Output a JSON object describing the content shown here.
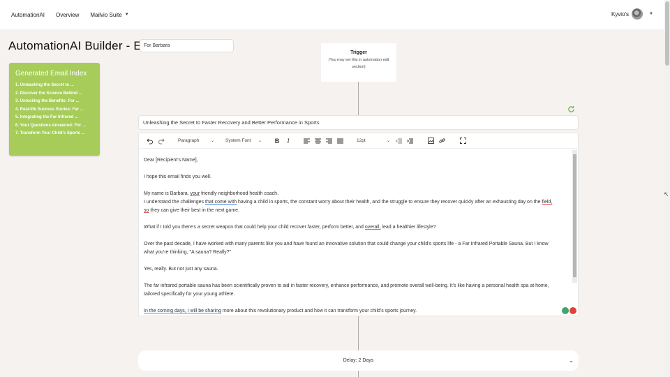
{
  "nav": {
    "brand": "AutomationAI",
    "overview": "Overview",
    "suite": "Mailvio Suite",
    "user": "Kyvio's"
  },
  "page": {
    "title": "AutomationAI Builder - Edit",
    "name_value": "For Barbara"
  },
  "index": {
    "title": "Generated Email Index",
    "items": [
      "1. Unleashing the Secret to ...",
      "2. Discover the Science Behind ...",
      "3. Unlocking the Benefits: For ...",
      "4. Real-life Success Stories: Far ...",
      "5. Integrating the Far Infrared ...",
      "6. Your Questions Answered: For ...",
      "7. Transform Your Child's Sports ..."
    ]
  },
  "trigger": {
    "title": "Trigger",
    "desc": "(You may set this in automation edit section)"
  },
  "email": {
    "subject": "Unleashing the Secret to Faster Recovery and Better Performance in Sports",
    "toolbar": {
      "block": "Paragraph",
      "font": "System Font",
      "size": "12pt"
    },
    "body": {
      "greeting": "Dear [Recipient's Name],",
      "hope": "I hope this email finds you well.",
      "intro_a": "My name is Barbara, ",
      "intro_u": "your",
      "intro_b": " friendly neighborhood health coach.",
      "understand_a": "I understand the challenges ",
      "understand_u": "that come with",
      "understand_b": " having a child in sports, the constant worry about their health, and the struggle to ensure they recover quickly after an exhausting day on the ",
      "understand_u2": "field,",
      "understand_c": " so",
      "understand_d": " they can give their best in the next game.",
      "whatif_a": "What if I told you there's a secret weapon that could help your child recover faster, perform better, and ",
      "whatif_u": "overall,",
      "whatif_b": " lead a healthier lifestyle?",
      "decade_1": "Over the past decade, I have worked with many parents like you and have found an innovative solution that could change your child's sports life - a Far Infrared Portable Sauna. But I know",
      "decade_2": "what you're thinking, \"A sauna? Really?\"",
      "yes": "Yes, really. But not just any sauna.",
      "far_1": "The far infrared portable sauna has been scientifically proven to aid in faster recovery, enhance performance, and promote overall well-being. It's like having a personal health spa at home,",
      "far_2": "tailored specifically for your young athlete.",
      "coming_u": "In the coming days, I will be sharing",
      "coming_b": " more about this revolutionary product and how it can transform your child's sports journey."
    }
  },
  "delay": {
    "label": "Delay: 2 Days"
  },
  "colors": {
    "index_bg": "#a7cc5a",
    "page_bg": "#f6f2ef",
    "refresh": "#6dbb3f"
  }
}
